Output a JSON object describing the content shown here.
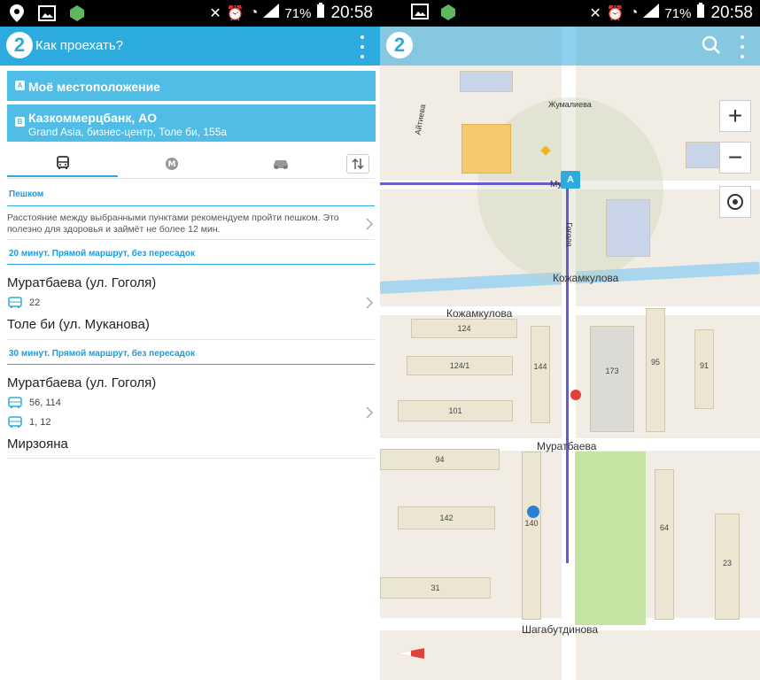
{
  "status_left": {
    "time": "20:58",
    "battery": "71%"
  },
  "status_right": {
    "time": "20:58",
    "battery": "71%"
  },
  "header": {
    "title": "Как проехать?",
    "logo": "2"
  },
  "from": {
    "label": "Моё местоположение",
    "icon": "A"
  },
  "to": {
    "label": "Казкоммерцбанк, АО",
    "sub": "Grand Asia, бизнес-центр, Толе би, 155а",
    "icon": "B"
  },
  "tabs": [
    {
      "name": "bus-icon",
      "active": true
    },
    {
      "name": "metro-icon",
      "active": false
    },
    {
      "name": "car-icon",
      "active": false
    }
  ],
  "walk": {
    "title": "Пешком",
    "text": "Расстояние между выбранными пунктами рекомендуем пройти пешком. Это полезно для здоровья и займёт не более 12 мин."
  },
  "route1": {
    "title": "20 минут. Прямой маршрут, без пересадок",
    "from": "Муратбаева (ул. Гоголя)",
    "bus": "22",
    "to": "Толе би (ул. Муканова)"
  },
  "route2": {
    "title": "30 минут. Прямой маршрут, без пересадок",
    "from": "Муратбаева (ул. Гоголя)",
    "bus1": "56, 114",
    "bus2": "1, 12",
    "to": "Мирзояна"
  },
  "map": {
    "streets": {
      "zhumaleva": "Жумалиева",
      "aitiev": "Айтиева",
      "muk": "Му",
      "kozh1": "Кожамкулова",
      "kozh2": "Кожамкулова",
      "gogolya": "Гоголя",
      "muratbaeva": "Муратбаева",
      "shag": "Шагабутдинова",
      "banner_a": "A"
    },
    "accent": "#2daade"
  }
}
